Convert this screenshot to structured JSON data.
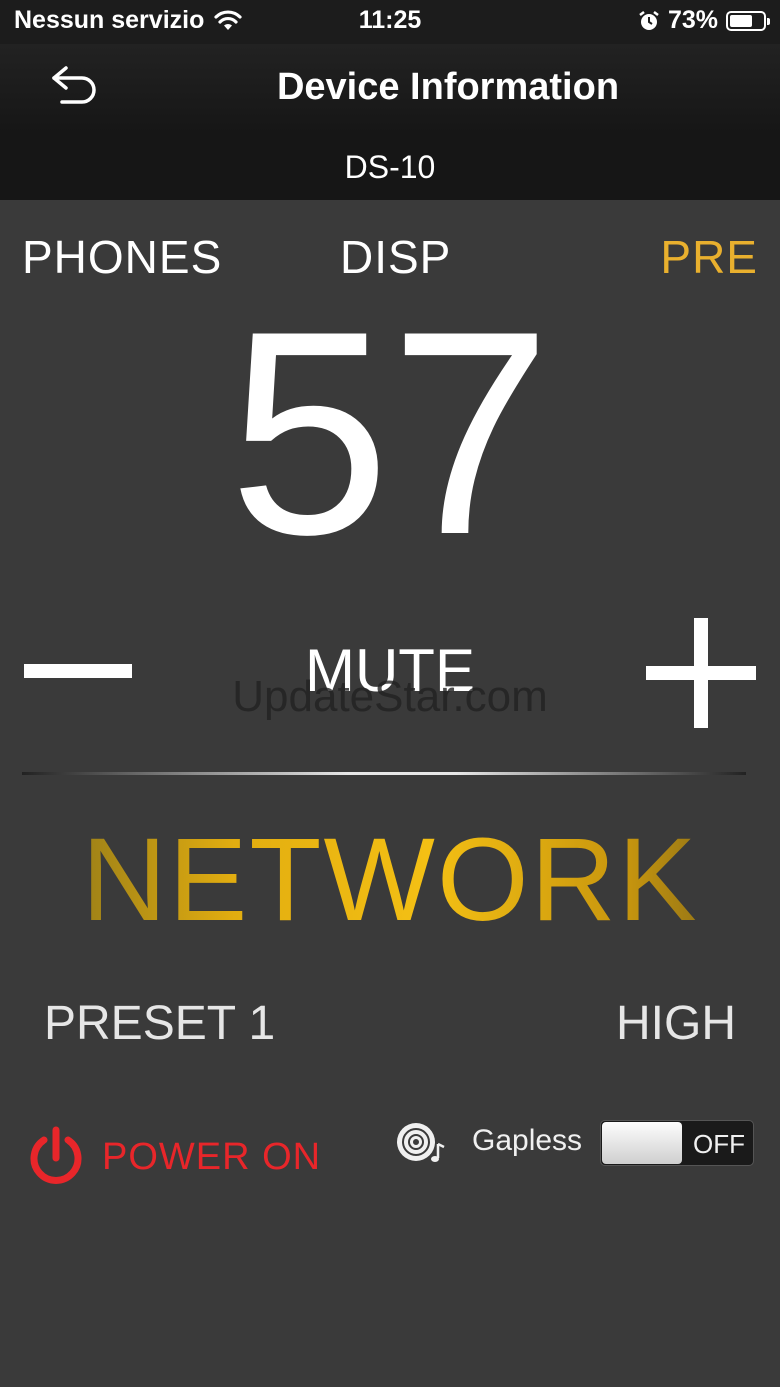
{
  "status": {
    "carrier": "Nessun servizio",
    "time": "11:25",
    "battery_percent": "73%",
    "battery_level": 0.73,
    "icons": [
      "wifi-icon",
      "alarm-icon",
      "battery-icon"
    ]
  },
  "nav": {
    "title": "Device Information",
    "back_icon": "back-arrow-icon"
  },
  "device": {
    "name": "DS-10"
  },
  "modes": {
    "phones": "PHONES",
    "disp": "DISP",
    "pre": "PRE",
    "active_color": "#e9b02e"
  },
  "volume": {
    "value": "57"
  },
  "controls": {
    "mute": "MUTE",
    "minus_icon": "minus-icon",
    "plus_icon": "plus-icon"
  },
  "watermark": "UpdateStar.com",
  "source": {
    "name": "NETWORK",
    "color": "#f4c014"
  },
  "info": {
    "preset": "PRESET 1",
    "level": "HIGH"
  },
  "power": {
    "label": "POWER ON",
    "color": "#e8262a",
    "icon": "power-icon"
  },
  "gapless": {
    "label": "Gapless",
    "state": "OFF",
    "icon": "disc-icon"
  }
}
